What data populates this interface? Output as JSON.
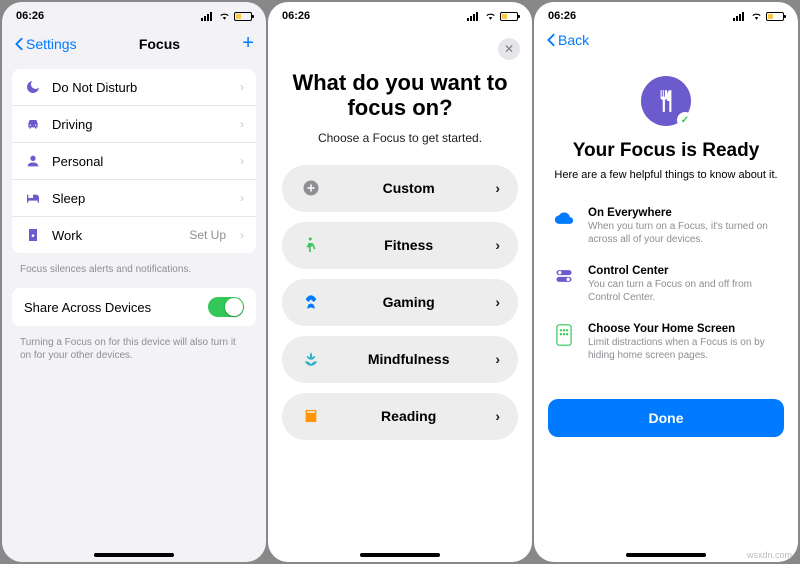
{
  "status": {
    "time": "06:26"
  },
  "p1": {
    "back": "Settings",
    "title": "Focus",
    "items": [
      {
        "label": "Do Not Disturb",
        "trailing": ""
      },
      {
        "label": "Driving",
        "trailing": ""
      },
      {
        "label": "Personal",
        "trailing": ""
      },
      {
        "label": "Sleep",
        "trailing": ""
      },
      {
        "label": "Work",
        "trailing": "Set Up"
      }
    ],
    "caption1": "Focus silences alerts and notifications.",
    "share": "Share Across Devices",
    "caption2": "Turning a Focus on for this device will also turn it on for your other devices."
  },
  "p2": {
    "title": "What do you want to focus on?",
    "sub": "Choose a Focus to get started.",
    "options": [
      {
        "label": "Custom"
      },
      {
        "label": "Fitness"
      },
      {
        "label": "Gaming"
      },
      {
        "label": "Mindfulness"
      },
      {
        "label": "Reading"
      }
    ]
  },
  "p3": {
    "back": "Back",
    "title": "Your Focus is Ready",
    "sub": "Here are a few helpful things to know about it.",
    "features": [
      {
        "title": "On Everywhere",
        "body": "When you turn on a Focus, it's turned on across all of your devices."
      },
      {
        "title": "Control Center",
        "body": "You can turn a Focus on and off from Control Center."
      },
      {
        "title": "Choose Your Home Screen",
        "body": "Limit distractions when a Focus is on by hiding home screen pages."
      }
    ],
    "done": "Done"
  },
  "watermark": "wsxdn.com"
}
